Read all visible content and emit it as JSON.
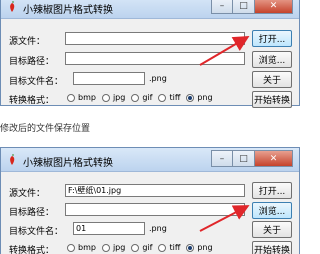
{
  "top": {
    "title": "小辣椒图片格式转换",
    "labels": {
      "source": "源文件：",
      "target_path": "目标路径：",
      "target_name": "目标文件名：",
      "format": "转换格式："
    },
    "fields": {
      "source": "",
      "target_path": "",
      "target_name": ""
    },
    "ext": ".png",
    "buttons": {
      "open": "打开...",
      "browse": "浏览...",
      "about": "关于",
      "convert": "开始转换"
    },
    "formats": [
      {
        "label": "bmp",
        "selected": false
      },
      {
        "label": "jpg",
        "selected": false
      },
      {
        "label": "gif",
        "selected": false
      },
      {
        "label": "tiff",
        "selected": false
      },
      {
        "label": "png",
        "selected": true
      }
    ]
  },
  "caption": "修改后的文件保存位置",
  "bottom": {
    "title": "小辣椒图片格式转换",
    "labels": {
      "source": "源文件：",
      "target_path": "目标路径：",
      "target_name": "目标文件名：",
      "format": "转换格式："
    },
    "fields": {
      "source": "F:\\壁纸\\01.jpg",
      "target_path": "",
      "target_name": "01"
    },
    "ext": ".png",
    "buttons": {
      "open": "打开...",
      "browse": "浏览...",
      "about": "关于",
      "convert": "开始转换"
    },
    "formats": [
      {
        "label": "bmp",
        "selected": false
      },
      {
        "label": "jpg",
        "selected": false
      },
      {
        "label": "gif",
        "selected": false
      },
      {
        "label": "tiff",
        "selected": false
      },
      {
        "label": "png",
        "selected": true
      }
    ]
  },
  "window_controls": {
    "minimize": "–",
    "maximize": "□",
    "close": "✕"
  },
  "colors": {
    "arrow": "#e0262a",
    "title_gradient_top": "#d9e8f8",
    "title_gradient_bottom": "#bcd3ee"
  }
}
